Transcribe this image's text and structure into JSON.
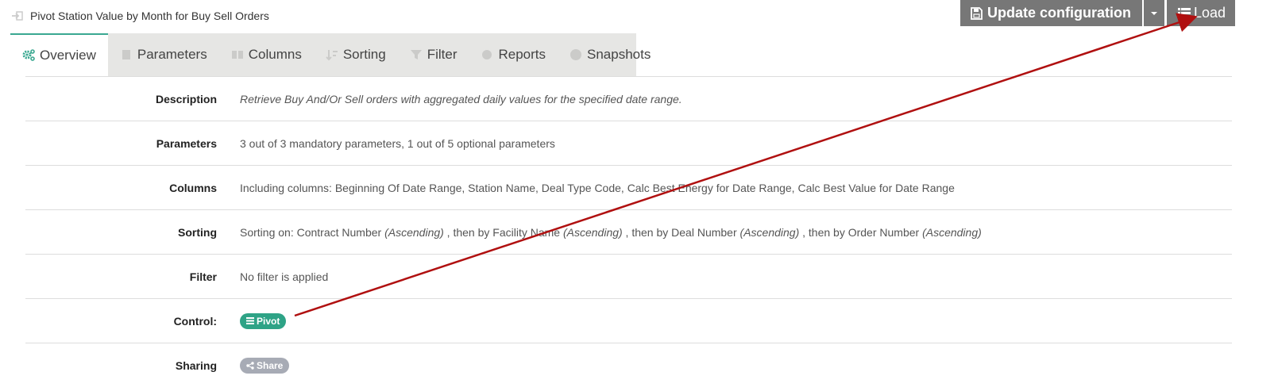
{
  "title": "Pivot Station Value by Month for Buy Sell Orders",
  "buttons": {
    "update": "Update configuration",
    "load": "Load"
  },
  "tabs": [
    {
      "label": "Overview",
      "icon": "gears-icon",
      "active": true
    },
    {
      "label": "Parameters",
      "icon": "filter-icon",
      "active": false
    },
    {
      "label": "Columns",
      "icon": "columns-icon",
      "active": false
    },
    {
      "label": "Sorting",
      "icon": "sort-icon",
      "active": false
    },
    {
      "label": "Filter",
      "icon": "funnel-icon",
      "active": false
    },
    {
      "label": "Reports",
      "icon": "reports-icon",
      "active": false
    },
    {
      "label": "Snapshots",
      "icon": "camera-icon",
      "active": false
    }
  ],
  "overview": {
    "description": {
      "label": "Description",
      "value": "Retrieve Buy And/Or Sell orders with aggregated daily values for the specified date range."
    },
    "parameters": {
      "label": "Parameters",
      "value": "3 out of 3 mandatory parameters, 1 out of 5 optional parameters"
    },
    "columns": {
      "label": "Columns",
      "value": "Including columns: Beginning Of Date Range, Station Name, Deal Type Code, Calc Best Energy for Date Range, Calc Best Value for Date Range"
    },
    "sorting": {
      "label": "Sorting",
      "prefix": "Sorting on: ",
      "items": [
        {
          "field": "Contract Number",
          "dir": "(Ascending)"
        },
        {
          "field": "Facility Name",
          "dir": "(Ascending)"
        },
        {
          "field": "Deal Number",
          "dir": "(Ascending)"
        },
        {
          "field": "Order Number",
          "dir": "(Ascending)"
        }
      ],
      "sep1": " , then by ",
      "sep2": " , then by ",
      "sep3": " , then by "
    },
    "filter": {
      "label": "Filter",
      "value": "No filter is applied"
    },
    "control": {
      "label": "Control:",
      "badge": "Pivot"
    },
    "sharing": {
      "label": "Sharing",
      "badge": "Share"
    }
  },
  "colors": {
    "accent": "#3aa891",
    "pivot_badge": "#2ea386",
    "share_badge": "#a7abb5",
    "button_bg": "#777777",
    "tab_bar_bg": "#e6e6e4",
    "annotation_arrow": "#b01010"
  }
}
